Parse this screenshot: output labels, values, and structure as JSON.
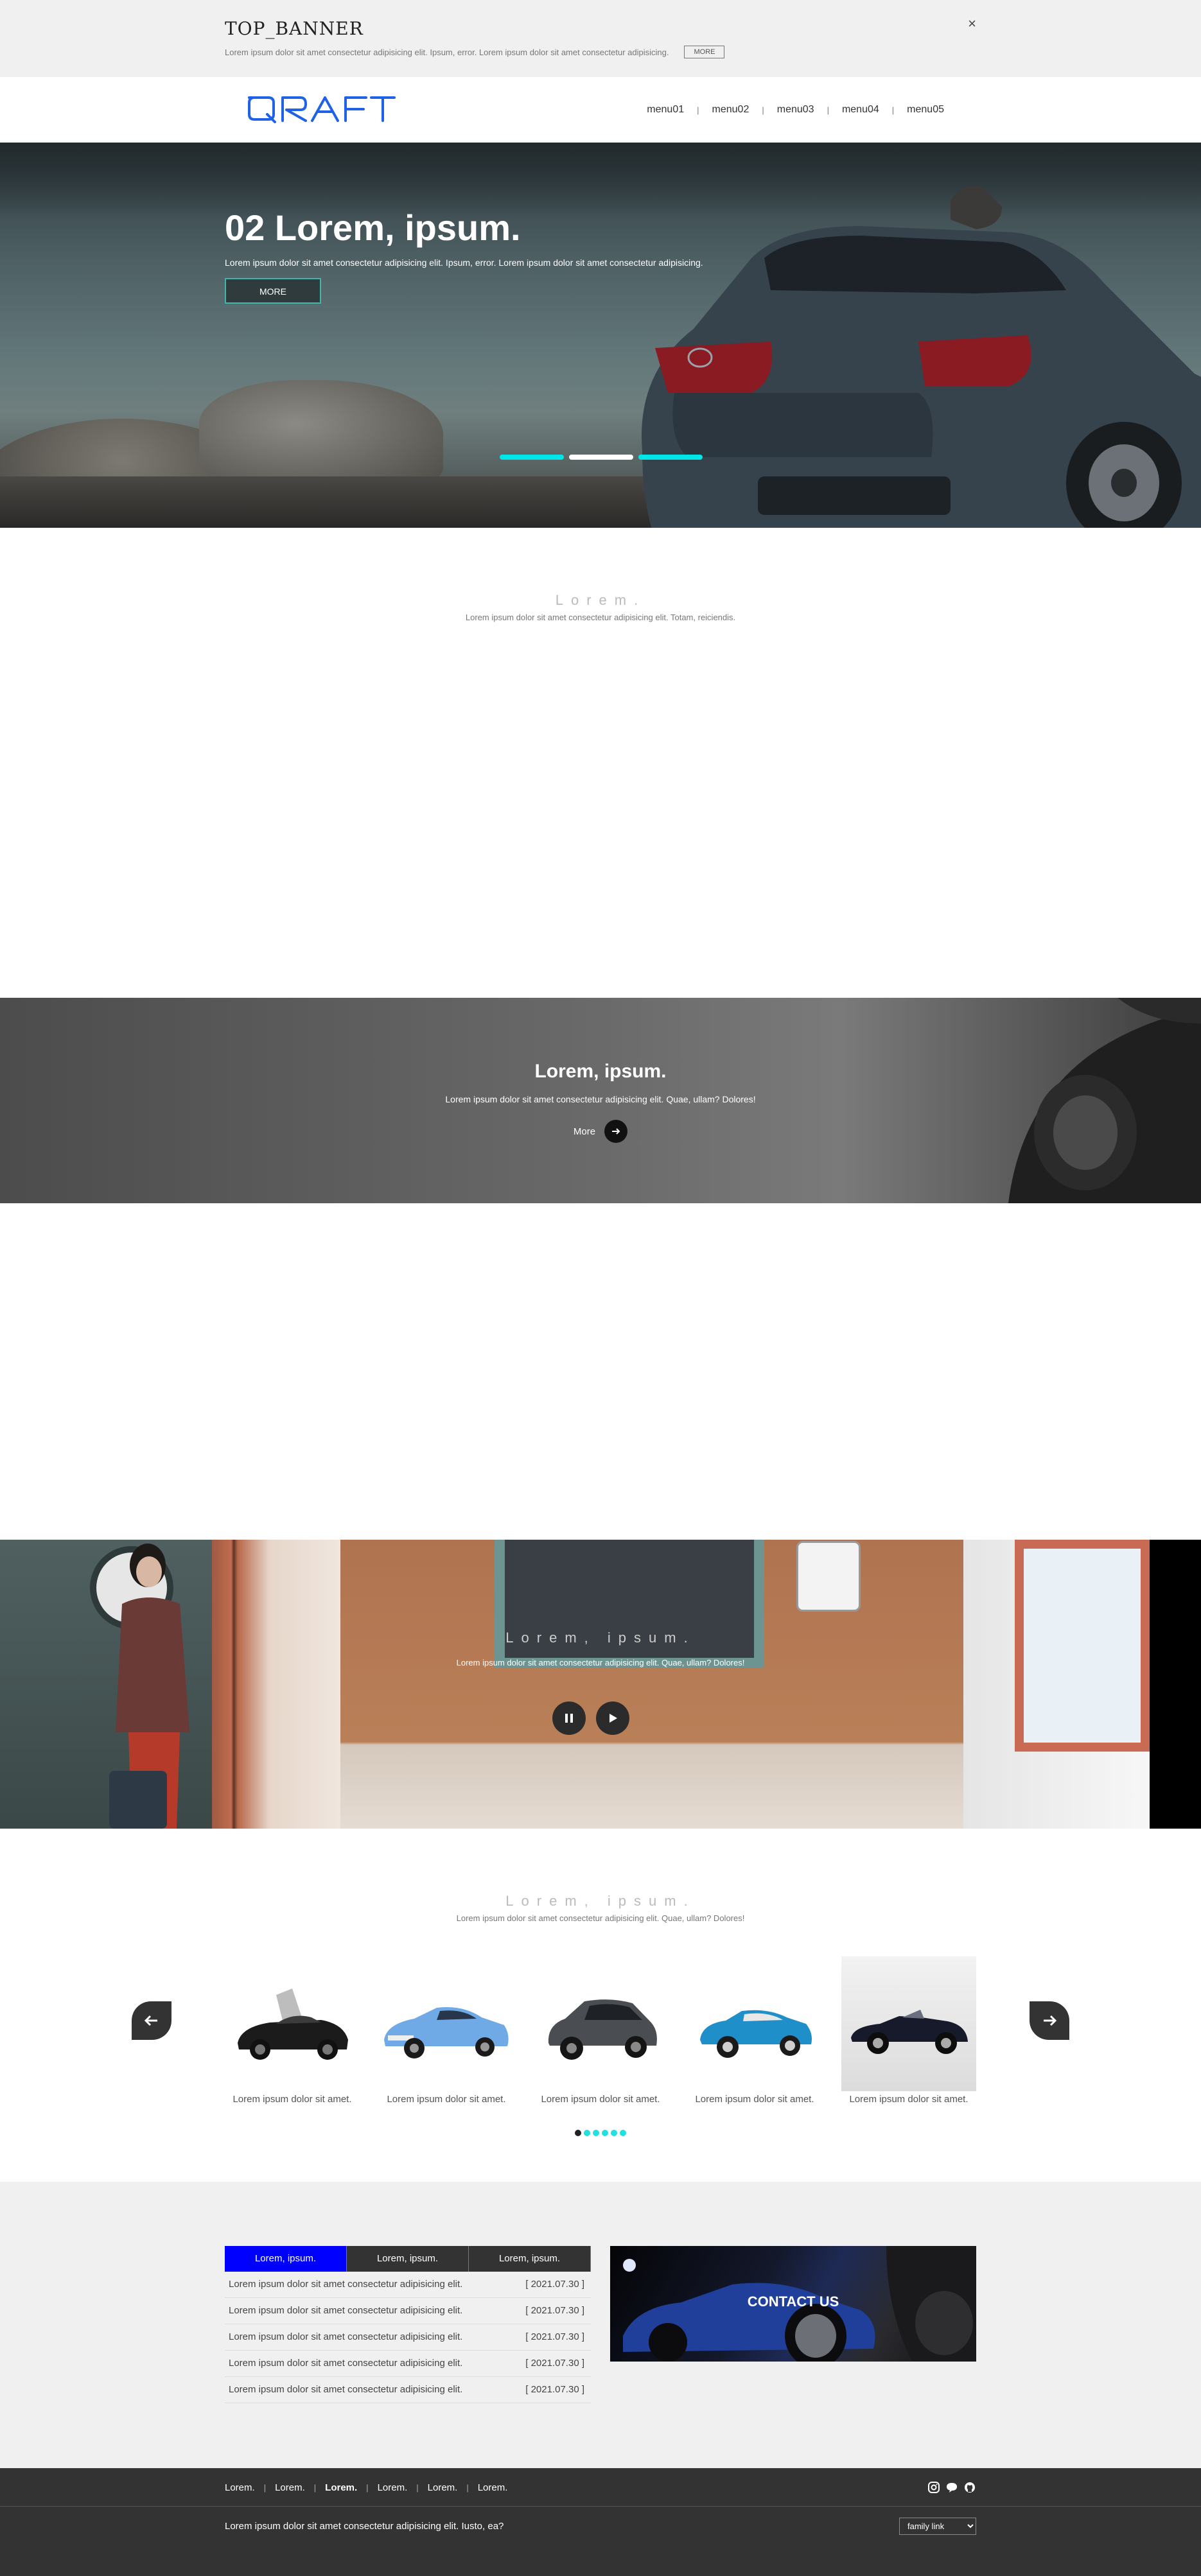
{
  "top_banner": {
    "title": "TOP_BANNER",
    "text": "Lorem ipsum dolor sit amet consectetur adipisicing elit. Ipsum, error. Lorem ipsum dolor sit amet consectetur adipisicing.",
    "more_label": "MORE",
    "close_label": "×"
  },
  "header": {
    "logo": "QRAFT",
    "menu": [
      "menu01",
      "menu02",
      "menu03",
      "menu04",
      "menu05"
    ],
    "separator": "|"
  },
  "hero": {
    "title": "02 Lorem, ipsum.",
    "subtitle": "Lorem ipsum dolor sit amet consectetur adipisicing elit. Ipsum, error. Lorem ipsum dolor sit amet consectetur adipisicing.",
    "more_label": "MORE",
    "active_slide": 2,
    "slide_count": 3,
    "accent": "#00e5e8"
  },
  "section1": {
    "title": "Lorem.",
    "subtitle": "Lorem ipsum dolor sit amet consectetur adipisicing elit. Totam, reiciendis."
  },
  "grey_banner": {
    "title": "Lorem, ipsum.",
    "subtitle": "Lorem ipsum dolor sit amet consectetur adipisicing elit. Quae, ullam? Dolores!",
    "more_label": "More"
  },
  "video": {
    "title": "Lorem, ipsum.",
    "subtitle": "Lorem ipsum dolor sit amet consectetur adipisicing elit. Quae, ullam? Dolores!"
  },
  "carousel": {
    "title": "Lorem, ipsum.",
    "subtitle": "Lorem ipsum dolor sit amet consectetur adipisicing elit. Quae, ullam? Dolores!",
    "items": [
      {
        "caption": "Lorem ipsum dolor sit amet.",
        "icon": "car-black-coupe"
      },
      {
        "caption": "Lorem ipsum dolor sit amet.",
        "icon": "car-blue-sedan"
      },
      {
        "caption": "Lorem ipsum dolor sit amet.",
        "icon": "car-grey-suv"
      },
      {
        "caption": "Lorem ipsum dolor sit amet.",
        "icon": "car-blue-toy"
      },
      {
        "caption": "Lorem ipsum dolor sit amet.",
        "icon": "car-black-convertible"
      }
    ],
    "active_dot": 1,
    "dot_count": 6
  },
  "board": {
    "tabs": [
      "Lorem, ipsum.",
      "Lorem, ipsum.",
      "Lorem, ipsum."
    ],
    "active_tab": 1,
    "rows": [
      {
        "text": "Lorem ipsum dolor sit amet consectetur adipisicing elit.",
        "date": "[ 2021.07.30 ]"
      },
      {
        "text": "Lorem ipsum dolor sit amet consectetur adipisicing elit.",
        "date": "[ 2021.07.30 ]"
      },
      {
        "text": "Lorem ipsum dolor sit amet consectetur adipisicing elit.",
        "date": "[ 2021.07.30 ]"
      },
      {
        "text": "Lorem ipsum dolor sit amet consectetur adipisicing elit.",
        "date": "[ 2021.07.30 ]"
      },
      {
        "text": "Lorem ipsum dolor sit amet consectetur adipisicing elit.",
        "date": "[ 2021.07.30 ]"
      }
    ],
    "contact_label": "CONTACT US",
    "tab_active_color": "#0000ff"
  },
  "footer": {
    "links": [
      "Lorem.",
      "Lorem.",
      "Lorem.",
      "Lorem.",
      "Lorem.",
      "Lorem."
    ],
    "bold_link_index": 2,
    "separator": "|",
    "icons": [
      "instagram-icon",
      "chat-icon",
      "github-icon"
    ],
    "copy": "Lorem ipsum dolor sit amet consectetur adipisicing elit. Iusto, ea?",
    "family_link": "family link"
  }
}
